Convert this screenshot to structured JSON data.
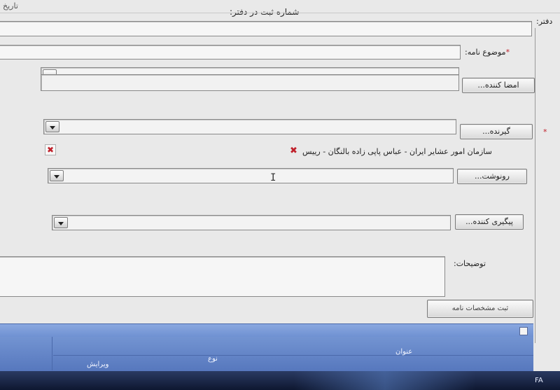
{
  "header": {
    "date_label": "تاریخ",
    "register_number_label": "شماره ثبت در دفتر:",
    "office_label": "دفتر:"
  },
  "form": {
    "subject_label": "موضوع نامه:",
    "required_mark": "*",
    "signer_button": "امضا کننده...",
    "recipient_button": "گیرنده...",
    "recipient_entry": "سازمان امور عشایر ایران - عباس پاپی زاده بالنگان - رییس",
    "cc_button": "رونوشت...",
    "follow_up_button": "پیگیری کننده...",
    "description_label": "توضیحات:",
    "submit_button": "ثبت مشخصات نامه"
  },
  "grid": {
    "columns": [
      "عنوان",
      "نوع",
      "ویرایش"
    ]
  },
  "taskbar": {
    "language": "FA"
  },
  "icons": {
    "remove": "remove-x-icon",
    "dropdown": "chevron-down-icon",
    "cursor": "text-cursor-icon"
  },
  "colors": {
    "remove_icon": "#c0202a",
    "grid_header": "#6b8fd0",
    "taskbar": "#1a2748"
  }
}
